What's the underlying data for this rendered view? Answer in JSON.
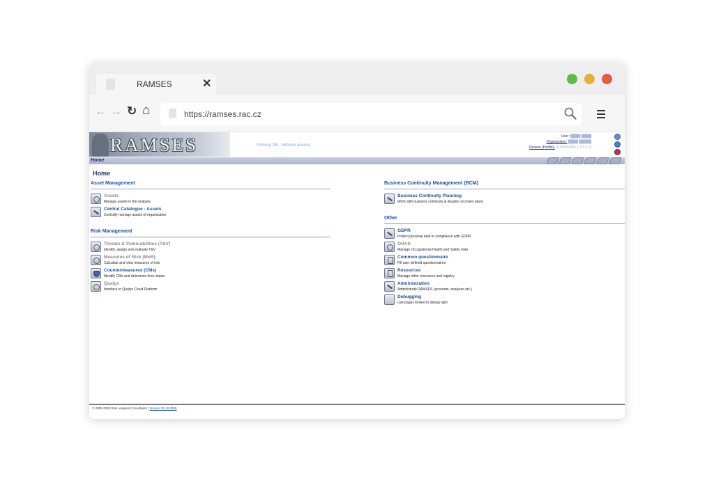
{
  "browser": {
    "tab_title": "RAMSES",
    "close_glyph": "✕",
    "url": "https://ramses.rac.cz",
    "back_glyph": "←",
    "forward_glyph": "→",
    "reload_glyph": "↻",
    "home_glyph": "⌂",
    "traffic_lights": [
      "#5dbb46",
      "#e8b03a",
      "#e05c4c"
    ]
  },
  "header": {
    "logo_text": "RAMSES",
    "db_info": "Primary DB - Internet access",
    "user_label": "User:",
    "user_value": "████ ████",
    "org_label": "Organization:",
    "org_value": "████ █████",
    "review_label": "Review (Profile):",
    "review_value": "[STANDARD 1.1/3.4.0]"
  },
  "nav": {
    "home": "Home"
  },
  "page": {
    "title": "Home"
  },
  "sections": {
    "asset_management": {
      "title": "Asset Management",
      "items": [
        {
          "name": "Assets",
          "desc": "Manage assets in the analysis",
          "active": false
        },
        {
          "name": "Central Catalogue - Assets",
          "desc": "Centrally manage assets of organization",
          "active": true
        }
      ]
    },
    "risk_management": {
      "title": "Risk Management",
      "items": [
        {
          "name": "Threats & Vulnerabilities (T&V)",
          "desc": "Identify, assign and evaluate T&V",
          "active": false
        },
        {
          "name": "Measures of Risk (MoR)",
          "desc": "Calculate and view measures of risk",
          "active": false
        },
        {
          "name": "Countermeasures (CMs)",
          "desc": "Identify CMs and determine their status",
          "active": true
        },
        {
          "name": "Qualys",
          "desc": "Interface to Qualys Cloud Platform",
          "active": false
        }
      ]
    },
    "bcm": {
      "title": "Business Continuity Management (BCM)",
      "items": [
        {
          "name": "Business Continuity Planning",
          "desc": "Work with business continuity & disaster recovery plans",
          "active": true
        }
      ]
    },
    "other": {
      "title": "Other",
      "items": [
        {
          "name": "GDPR",
          "desc": "Protect personal data in compliance with GDPR",
          "active": true
        },
        {
          "name": "OHAS",
          "desc": "Manage Occupational Health and Safety risks",
          "active": false
        },
        {
          "name": "Common questionnaire",
          "desc": "Fill user defined questionnaires",
          "active": true
        },
        {
          "name": "Resources",
          "desc": "Manage other resources and registry",
          "active": true
        },
        {
          "name": "Administration",
          "desc": "Administrate RAMSES (accounts, analyses etc.)",
          "active": true
        },
        {
          "name": "Debugging",
          "desc": "Use pages limited to debug right",
          "active": true
        }
      ]
    }
  },
  "footer": {
    "copyright": "© 2005-2038 Risk Analysis Consultants |",
    "version": "Version 31.10.2038"
  }
}
